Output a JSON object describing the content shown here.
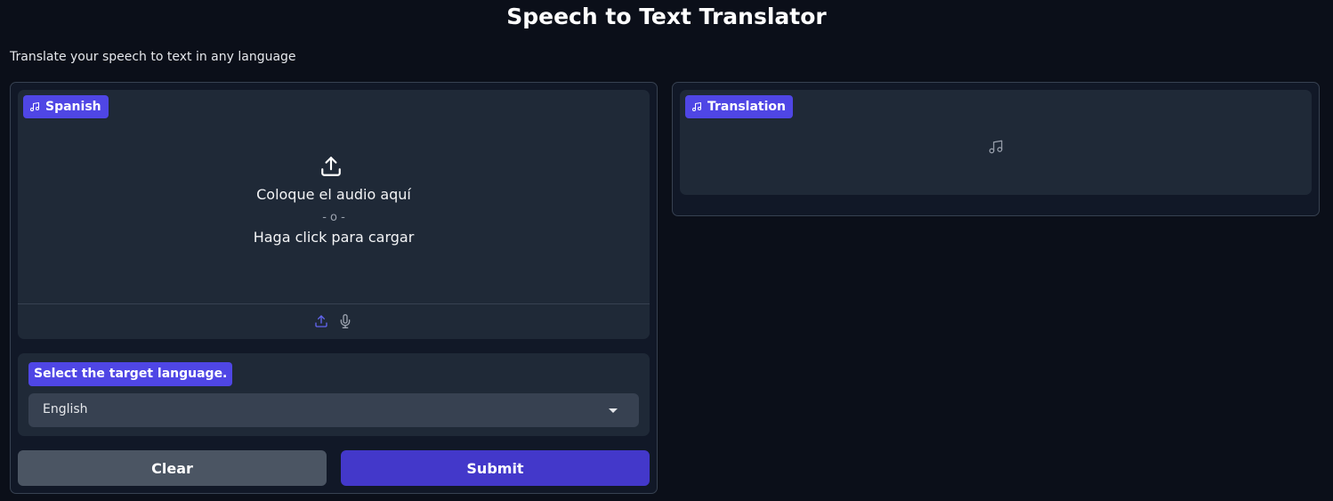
{
  "header": {
    "title": "Speech to Text Translator",
    "description": "Translate your speech to text in any language"
  },
  "input_audio": {
    "label": "Spanish",
    "label_icon": "music-note-icon",
    "drop_text": "Coloque el audio aquí",
    "or_text": "- o -",
    "click_text": "Haga click para cargar",
    "source_icons": [
      "upload-icon",
      "microphone-icon"
    ]
  },
  "language_select": {
    "label": "Select the target language.",
    "selected": "English"
  },
  "buttons": {
    "clear": "Clear",
    "submit": "Submit"
  },
  "output_audio": {
    "label": "Translation",
    "label_icon": "music-note-icon",
    "placeholder_icon": "music-note-icon"
  },
  "colors": {
    "background": "#0b0f19",
    "panel": "#111827",
    "block": "#1f2937",
    "accent": "#4f46e5",
    "submit": "#4338ca",
    "clear": "#4b5563"
  }
}
